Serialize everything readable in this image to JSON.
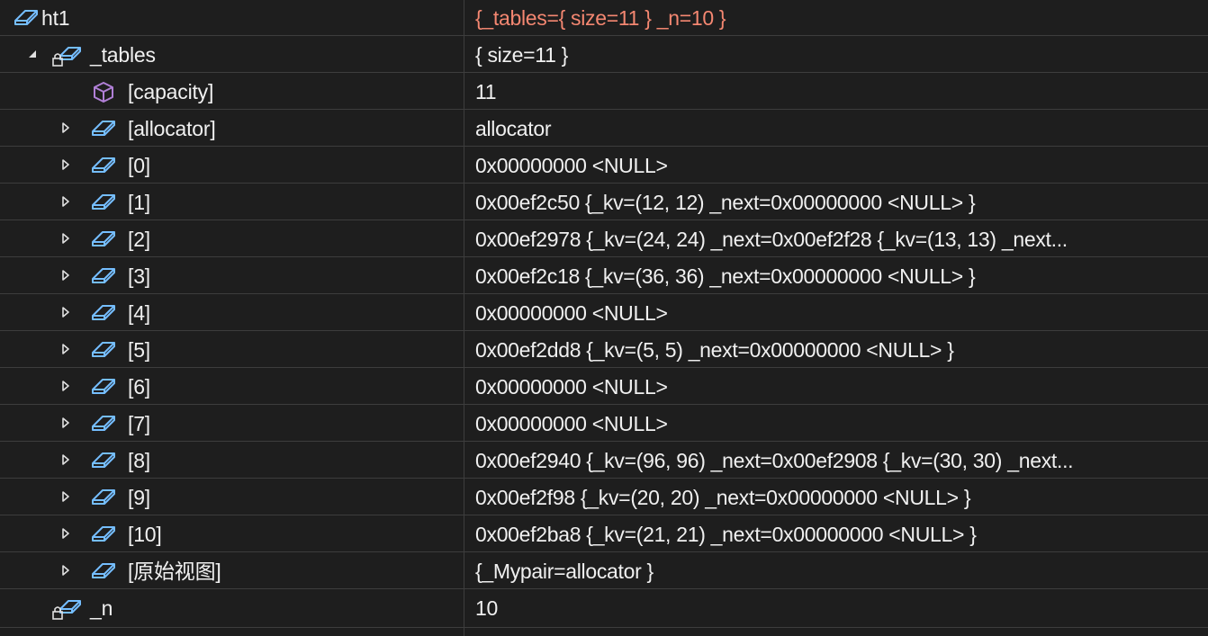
{
  "rows": [
    {
      "name": "ht1",
      "value": "{_tables={ size=11 } _n=10 }",
      "value_color": "#f48771",
      "icon": "object-icon",
      "expander": "none"
    },
    {
      "name": "_tables",
      "value": "{ size=11 }",
      "icon": "private-field-icon",
      "expander": "expanded"
    },
    {
      "name": "[capacity]",
      "value": "11",
      "icon": "property-cube-icon",
      "expander": "none"
    },
    {
      "name": "[allocator]",
      "value": "allocator",
      "icon": "object-icon",
      "expander": "collapsed"
    },
    {
      "name": "[0]",
      "value": "0x00000000 <NULL>",
      "icon": "object-icon",
      "expander": "collapsed"
    },
    {
      "name": "[1]",
      "value": "0x00ef2c50 {_kv=(12, 12) _next=0x00000000 <NULL> }",
      "icon": "object-icon",
      "expander": "collapsed"
    },
    {
      "name": "[2]",
      "value": "0x00ef2978 {_kv=(24, 24) _next=0x00ef2f28 {_kv=(13, 13) _next...",
      "icon": "object-icon",
      "expander": "collapsed"
    },
    {
      "name": "[3]",
      "value": "0x00ef2c18 {_kv=(36, 36) _next=0x00000000 <NULL> }",
      "icon": "object-icon",
      "expander": "collapsed"
    },
    {
      "name": "[4]",
      "value": "0x00000000 <NULL>",
      "icon": "object-icon",
      "expander": "collapsed"
    },
    {
      "name": "[5]",
      "value": "0x00ef2dd8 {_kv=(5, 5) _next=0x00000000 <NULL> }",
      "icon": "object-icon",
      "expander": "collapsed"
    },
    {
      "name": "[6]",
      "value": "0x00000000 <NULL>",
      "icon": "object-icon",
      "expander": "collapsed"
    },
    {
      "name": "[7]",
      "value": "0x00000000 <NULL>",
      "icon": "object-icon",
      "expander": "collapsed"
    },
    {
      "name": "[8]",
      "value": "0x00ef2940 {_kv=(96, 96) _next=0x00ef2908 {_kv=(30, 30) _next...",
      "icon": "object-icon",
      "expander": "collapsed"
    },
    {
      "name": "[9]",
      "value": "0x00ef2f98 {_kv=(20, 20) _next=0x00000000 <NULL> }",
      "icon": "object-icon",
      "expander": "collapsed"
    },
    {
      "name": "[10]",
      "value": "0x00ef2ba8 {_kv=(21, 21) _next=0x00000000 <NULL> }",
      "icon": "object-icon",
      "expander": "collapsed"
    },
    {
      "name": "[原始视图]",
      "value": "{_Mypair=allocator }",
      "icon": "object-icon",
      "expander": "collapsed"
    },
    {
      "name": "_n",
      "value": "10",
      "icon": "private-field-icon",
      "expander": "none"
    }
  ],
  "colors": {
    "background": "#1e1e1e",
    "grid": "#3d3d3d",
    "text": "#f0f0f0",
    "changed_value": "#f48771",
    "object_icon": "#75beff",
    "property_icon": "#b180d7"
  }
}
